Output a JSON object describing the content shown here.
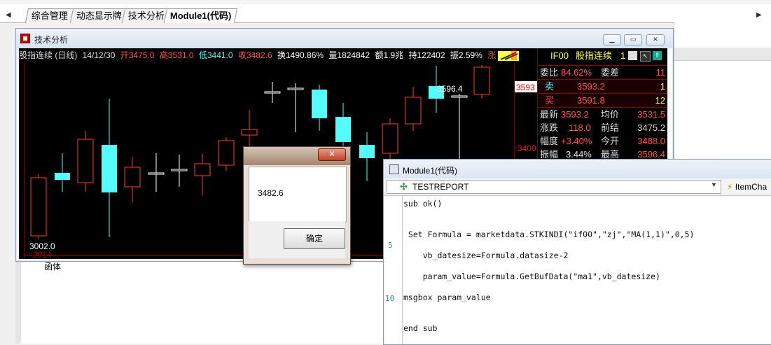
{
  "tabs": [
    {
      "label": "综合管理"
    },
    {
      "label": "动态显示牌"
    },
    {
      "label": "技术分析"
    },
    {
      "label": "Module1(代码)"
    }
  ],
  "left_panel": {
    "text": "函体"
  },
  "ta_window": {
    "title": "技术分析",
    "header": {
      "name": "股指连续 (日线)",
      "date": "14/12/30",
      "open": "开3475.0",
      "high": "高3531.0",
      "low": "低3441.0",
      "close": "收3482.6",
      "turnover": "换1490.86%",
      "volume": "量1824842",
      "amount": "额1.9兆",
      "position": "持122402",
      "amplitude": "振2.59%",
      "rise": "涨"
    },
    "price_tags": {
      "current": "3593",
      "level": "3400",
      "peak": "3596.4",
      "trough": "3002.0",
      "year": "2014"
    },
    "quote": {
      "symbol": "IF00",
      "name": "股指连续",
      "num": "1",
      "ratio_label": "委比",
      "ratio_value": "84.62%",
      "diff_label": "委差",
      "diff_value": "11",
      "sell_label": "卖",
      "sell_price": "3593.2",
      "sell_qty": "1",
      "buy_label": "买",
      "buy_price": "3591.8",
      "buy_qty": "12",
      "rows": [
        {
          "l1": "最新",
          "v1": "3593.2",
          "l2": "均价",
          "v2": "3531.5"
        },
        {
          "l1": "涨跌",
          "v1": "118.0",
          "l2": "前结",
          "v2": "3475.2"
        },
        {
          "l1": "幅度",
          "v1": "+3.40%",
          "l2": "今开",
          "v2": "3488.0"
        },
        {
          "l1": "振幅",
          "v1": "3.44%",
          "l2": "最高",
          "v2": "3596.4"
        }
      ]
    },
    "colors": {
      "up": "#ff3c3c",
      "down": "#54fcfc",
      "cross": "#ffffff"
    }
  },
  "msgbox": {
    "close_label": "✕",
    "message": "3482.6",
    "ok_label": "确定"
  },
  "module_window": {
    "title": "Module1(代码)",
    "combo_label": "TESTREPORT",
    "item_label": "ItemCha",
    "line_numbers": [
      "5",
      "10"
    ],
    "code": [
      "sub ok()",
      " Set Formula = marketdata.STKINDI(\"if00\",\"zj\",\"MA(1,1)\",0,5)",
      "    vb_datesize=Formula.datasize-2",
      "    param_value=Formula.GetBufData(\"ma1\",vb_datesize)",
      "msgbox param_value",
      "end sub"
    ]
  }
}
